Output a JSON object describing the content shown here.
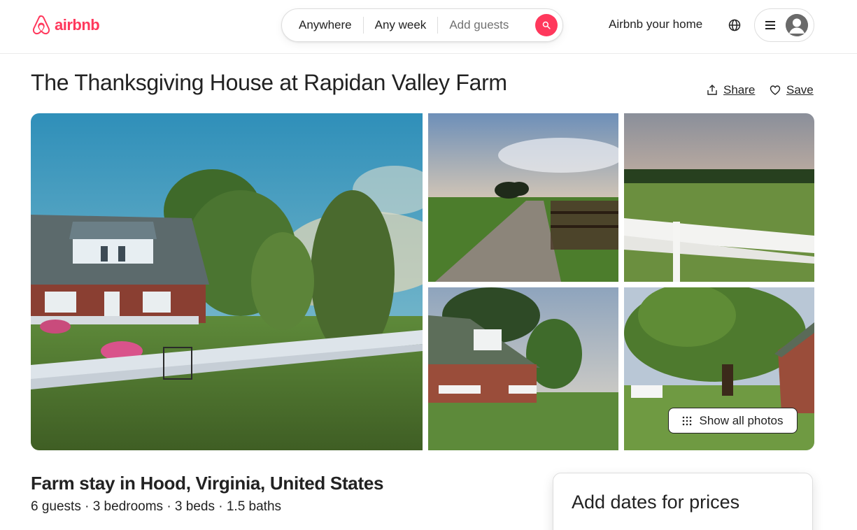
{
  "header": {
    "logo_text": "airbnb",
    "search": {
      "where": "Anywhere",
      "when": "Any week",
      "who": "Add guests"
    },
    "host_link": "Airbnb your home"
  },
  "listing": {
    "title": "The Thanksgiving House at Rapidan Valley Farm",
    "share_label": "Share",
    "save_label": "Save",
    "show_all_photos": "Show all photos",
    "subtitle": "Farm stay in Hood, Virginia, United States",
    "details": "6 guests · 3 bedrooms · 3 beds · 1.5 baths"
  },
  "booking": {
    "title": "Add dates for prices"
  },
  "colors": {
    "brand": "#ff385c",
    "text": "#222222",
    "muted": "#717171",
    "border": "#dddddd"
  },
  "icons": [
    "airbnb-logo-icon",
    "search-icon",
    "globe-icon",
    "menu-icon",
    "user-avatar-icon",
    "share-icon",
    "heart-icon",
    "grid-dots-icon"
  ]
}
